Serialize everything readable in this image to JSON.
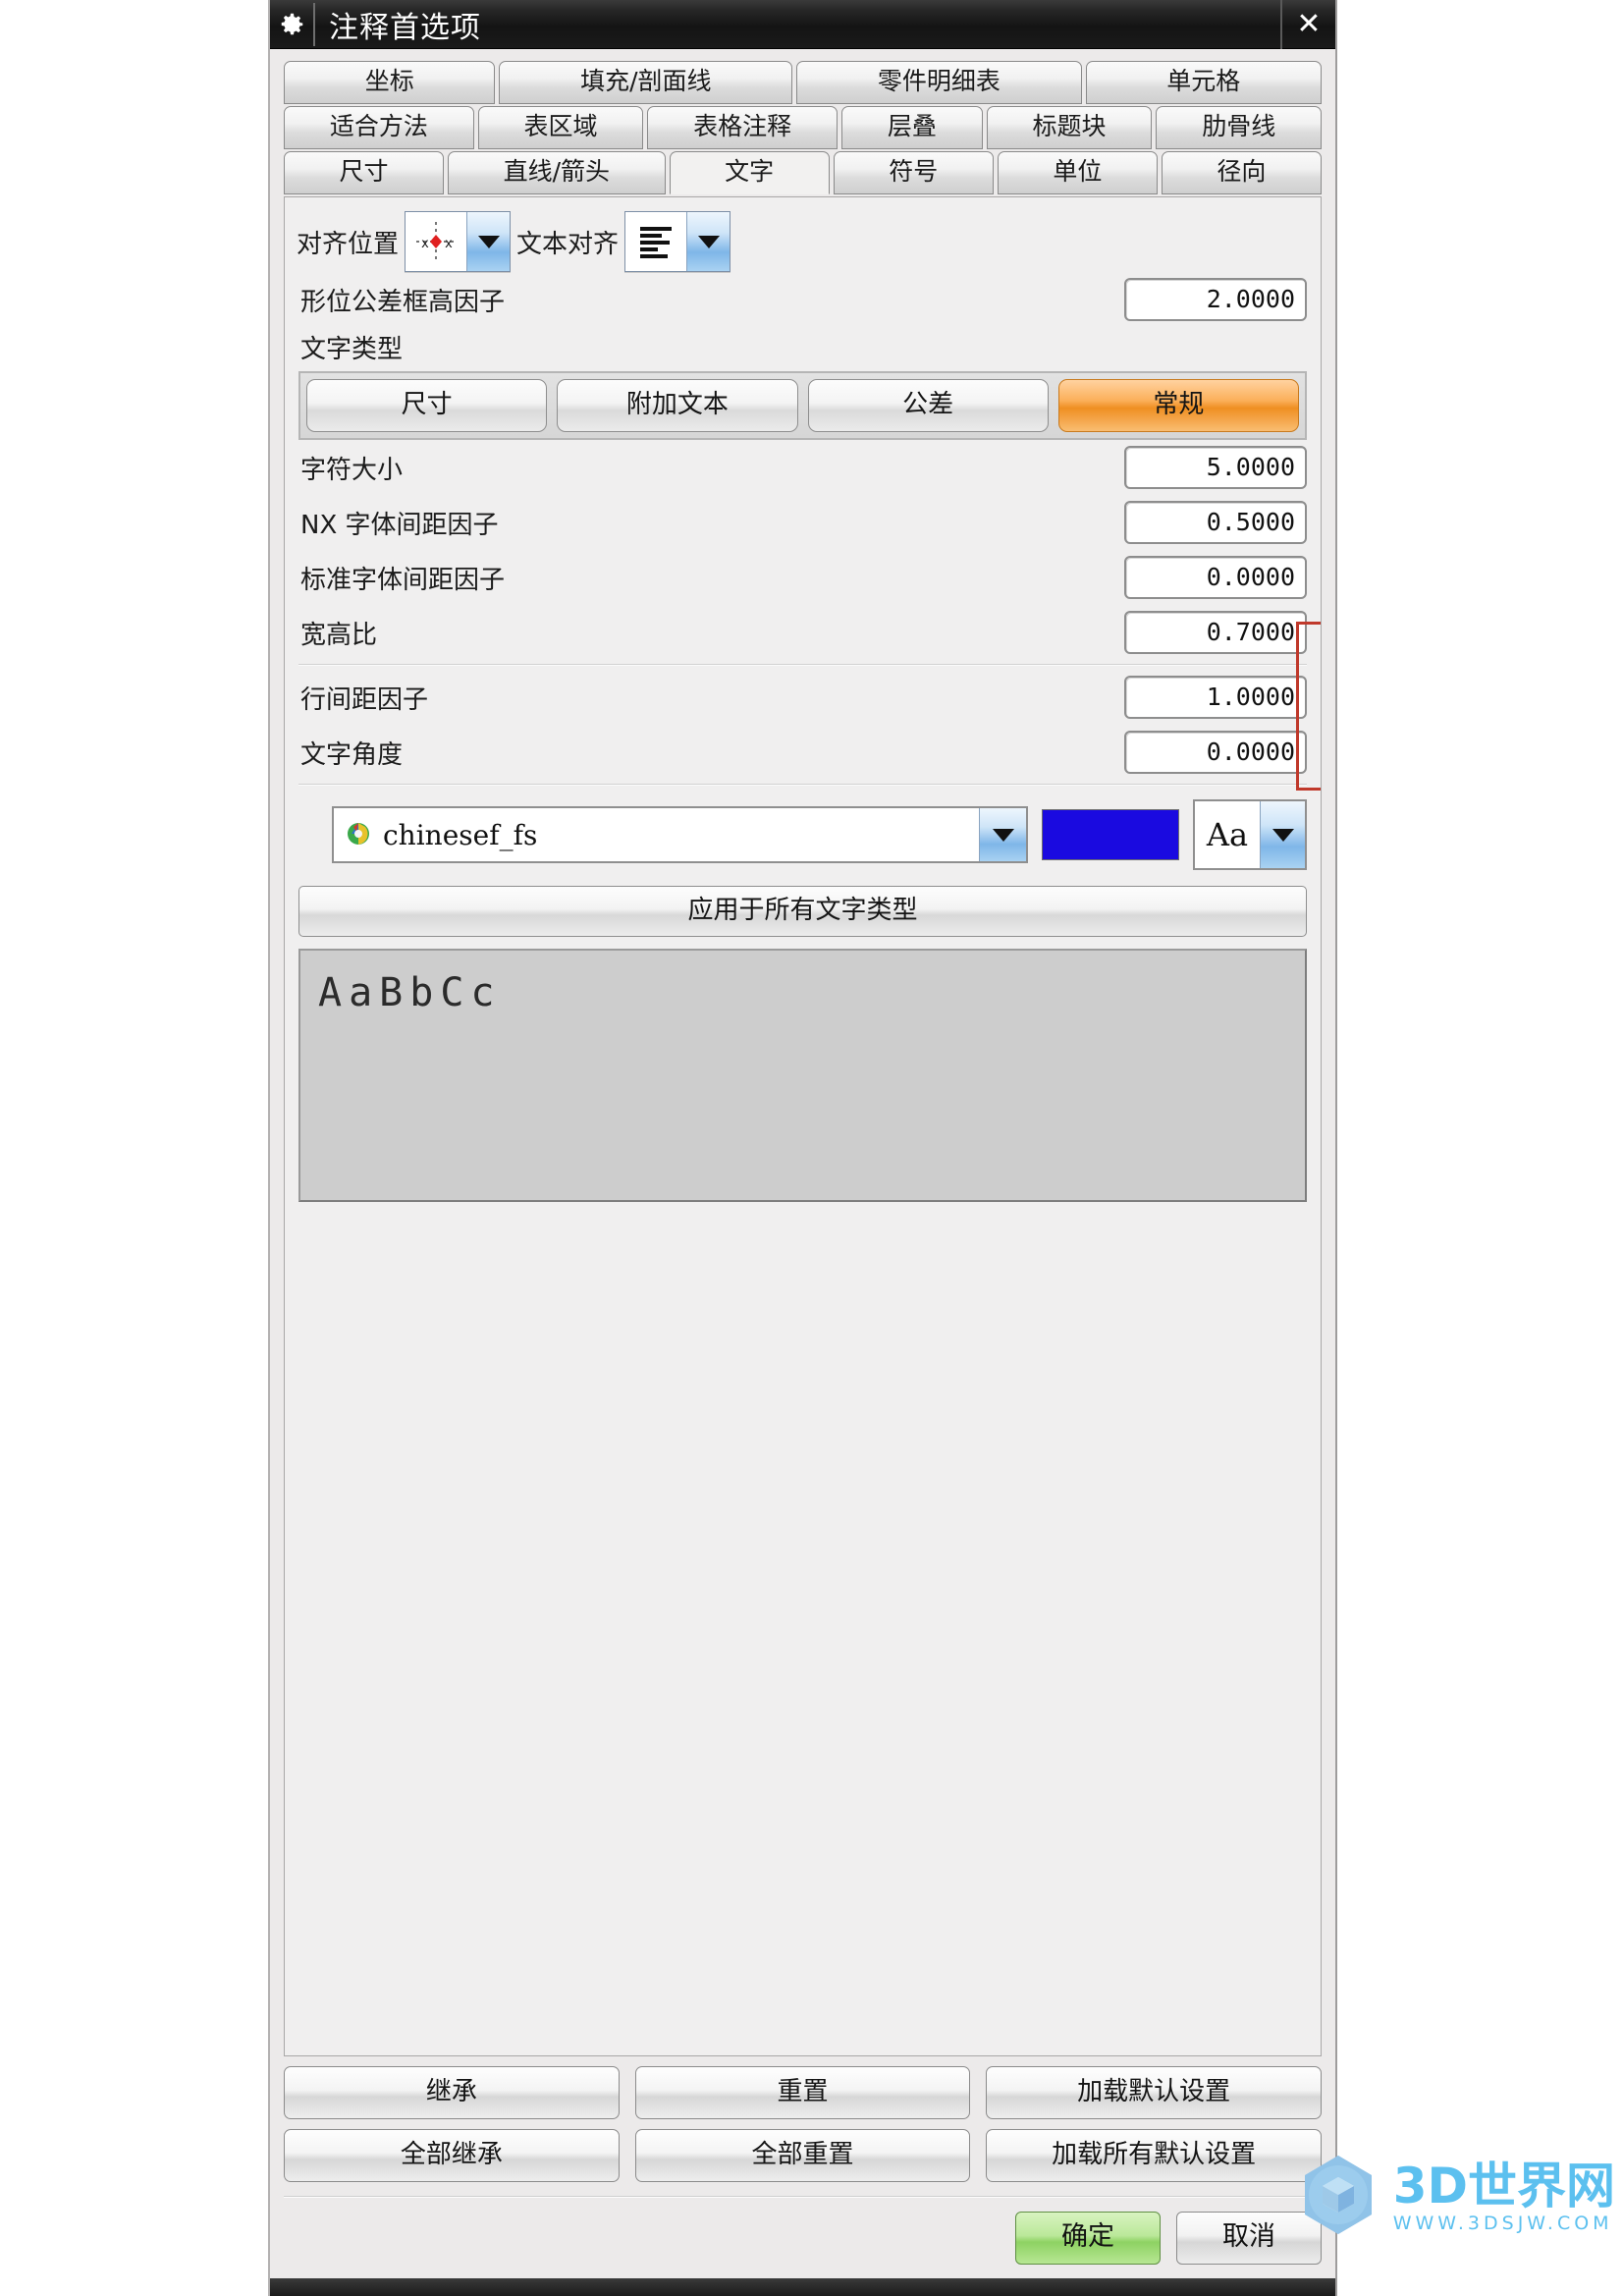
{
  "window": {
    "title": "注释首选项",
    "gear_icon": "gear-icon",
    "close_icon": "close-icon"
  },
  "tabs": {
    "row1": [
      {
        "label": "坐标",
        "active": false
      },
      {
        "label": "填充/剖面线",
        "active": false
      },
      {
        "label": "零件明细表",
        "active": false
      },
      {
        "label": "单元格",
        "active": false
      }
    ],
    "row2": [
      {
        "label": "适合方法",
        "active": false
      },
      {
        "label": "表区域",
        "active": false
      },
      {
        "label": "表格注释",
        "active": false
      },
      {
        "label": "层叠",
        "active": false
      },
      {
        "label": "标题块",
        "active": false
      },
      {
        "label": "肋骨线",
        "active": false
      }
    ],
    "row3": [
      {
        "label": "尺寸",
        "active": false
      },
      {
        "label": "直线/箭头",
        "active": false
      },
      {
        "label": "文字",
        "active": true
      },
      {
        "label": "符号",
        "active": false
      },
      {
        "label": "单位",
        "active": false
      },
      {
        "label": "径向",
        "active": false
      }
    ]
  },
  "text_tab": {
    "align_position_label": "对齐位置",
    "align_position_icon": "alignment-anchor-icon",
    "text_align_label": "文本对齐",
    "text_align_icon": "align-left-icon",
    "gdt_frame_label": "形位公差框高因子",
    "gdt_frame_value": "2.0000",
    "text_type_label": "文字类型",
    "text_types": [
      {
        "label": "尺寸",
        "selected": false
      },
      {
        "label": "附加文本",
        "selected": false
      },
      {
        "label": "公差",
        "selected": false
      },
      {
        "label": "常规",
        "selected": true
      }
    ],
    "fields": [
      {
        "label": "字符大小",
        "value": "5.0000"
      },
      {
        "label": "NX 字体间距因子",
        "value": "0.5000"
      },
      {
        "label": "标准字体间距因子",
        "value": "0.0000"
      },
      {
        "label": "宽高比",
        "value": "0.7000"
      }
    ],
    "fields2": [
      {
        "label": "行间距因子",
        "value": "1.0000"
      },
      {
        "label": "文字角度",
        "value": "0.0000"
      }
    ],
    "font_name": "chinesef_fs",
    "font_icon": "font-file-icon",
    "color_swatch": "#1a0ae0",
    "case_selector": "Aa",
    "apply_all_label": "应用于所有文字类型",
    "preview_text": "AaBbCc"
  },
  "bottom_buttons": {
    "row1": [
      "继承",
      "重置",
      "加载默认设置"
    ],
    "row2": [
      "全部继承",
      "全部重置",
      "加载所有默认设置"
    ]
  },
  "footer": {
    "ok_label": "确定",
    "cancel_label": "取消"
  },
  "watermark": {
    "main": "3D世界网",
    "sub": "WWW.3DSJW.COM",
    "color": "#5cc0ef"
  },
  "annotation": {
    "color": "#c0392b"
  }
}
